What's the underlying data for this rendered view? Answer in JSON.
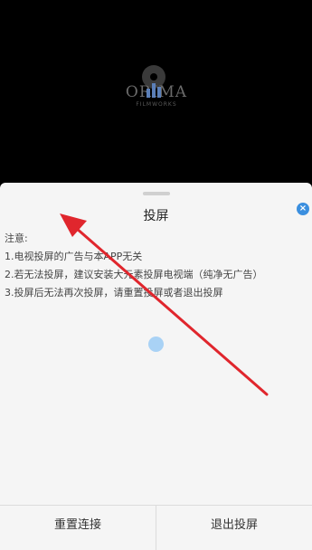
{
  "video": {
    "logo_text": "ORIMA",
    "logo_sub": "FILMWORKS"
  },
  "sheet": {
    "title": "投屏",
    "close_label": "×",
    "notes": [
      "注意:",
      "1.电视投屏的广告与本APP无关",
      "2.若无法投屏，建议安装大元素投屏电视端（纯净无广告）",
      "3.投屏后无法再次投屏，请重置投屏或者退出投屏"
    ]
  },
  "footer": {
    "reset_label": "重置连接",
    "exit_label": "退出投屏"
  },
  "colors": {
    "accent": "#3b8fdf",
    "annotation_arrow": "#e0262d"
  }
}
